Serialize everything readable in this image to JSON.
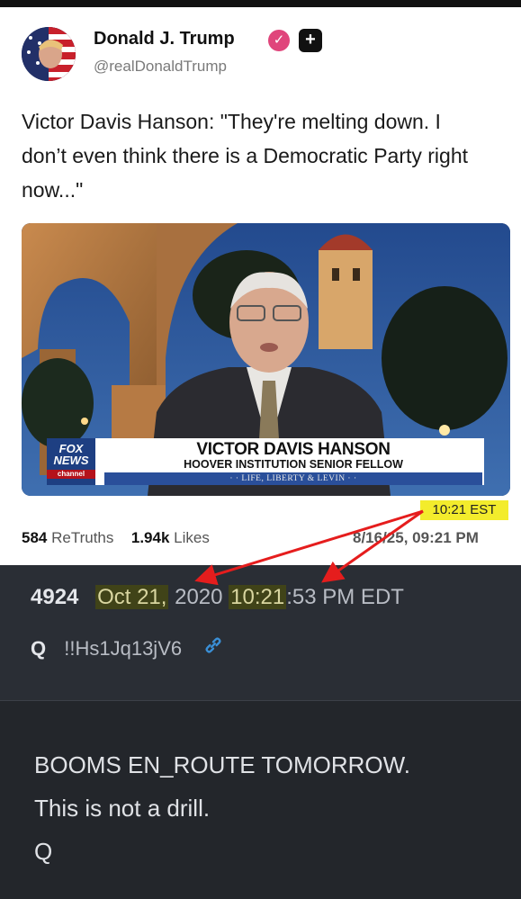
{
  "post": {
    "author_name": "Donald J. Trump",
    "handle": "@realDonaldTrump",
    "verified_icon": "verified-badge-icon",
    "plus_icon": "plus-badge-icon",
    "text": "Victor Davis Hanson: \"They're melting down. I don’t even think there is a Democratic Party right now...\"",
    "media": {
      "network": [
        "FOX",
        "NEWS",
        "channel"
      ],
      "guest_name": "VICTOR DAVIS HANSON",
      "guest_title": "HOOVER INSTITUTION SENIOR FELLOW",
      "show_strip": "· · LIFE, LIBERTY & LEVIN · ·"
    },
    "retruths_count": "584",
    "retruths_label": "ReTruths",
    "likes_count": "1.94k",
    "likes_label": "Likes",
    "date": "8/16/25, 09:21 PM",
    "est_annotation": "10:21 EST"
  },
  "drop": {
    "number": "4924",
    "date_highlight": "Oct 21,",
    "year": "2020",
    "time_highlight": "10:21",
    "time_rest": ":53 PM EDT",
    "author": "Q",
    "tripcode": "!!Hs1Jq13jV6",
    "link_icon": "link-icon",
    "body": [
      "BOOMS EN_ROUTE TOMORROW.",
      "This is not a drill.",
      "Q"
    ]
  },
  "colors": {
    "annotation_arrow": "#e51d1d",
    "annotation_highlight": "#f3ec2c",
    "verified": "#e0457b"
  }
}
